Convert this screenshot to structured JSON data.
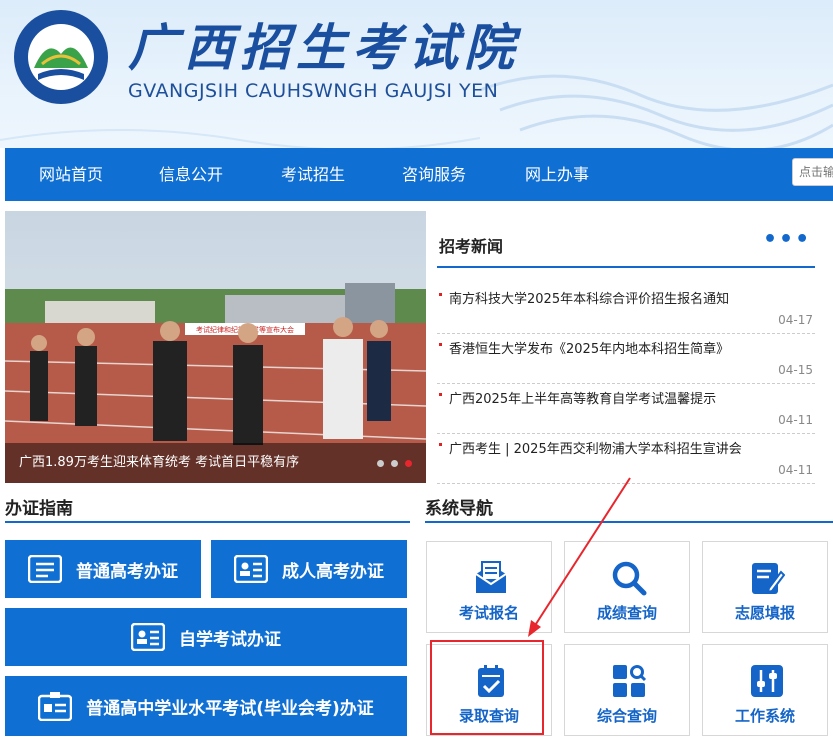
{
  "header": {
    "title": "广西招生考试院",
    "subtitle": "GVANGJSIH CAUHSWNGH GAUJSI YEN",
    "logo_text_top": "广西招生考试院",
    "logo_text_bottom": "GVANGJSIH CAUHSWNGH GAUJSI YEN"
  },
  "nav": {
    "items": [
      "网站首页",
      "信息公开",
      "考试招生",
      "咨询服务",
      "网上办事"
    ],
    "search_placeholder": "点击输"
  },
  "carousel": {
    "caption": "广西1.89万考生迎来体育统考 考试首日平稳有序",
    "banner_text": "考试纪律和纪律要求等宣布大会",
    "active_slide": 3,
    "slide_count": 3
  },
  "news": {
    "title": "招考新闻",
    "more": "•••",
    "items": [
      {
        "text": "南方科技大学2025年本科综合评价招生报名通知",
        "date": "04-17"
      },
      {
        "text": "香港恒生大学发布《2025年内地本科招生简章》",
        "date": "04-15"
      },
      {
        "text": "广西2025年上半年高等教育自学考试温馨提示",
        "date": "04-11"
      },
      {
        "text": "广西考生 | 2025年西交利物浦大学本科招生宣讲会",
        "date": "04-11"
      }
    ]
  },
  "guide": {
    "title": "办证指南",
    "buttons": [
      "普通高考办证",
      "成人高考办证",
      "自学考试办证",
      "普通高中学业水平考试(毕业会考)办证"
    ]
  },
  "system_nav": {
    "title": "系统导航",
    "tiles": [
      {
        "label": "考试报名",
        "icon": "exam-registration-icon"
      },
      {
        "label": "成绩查询",
        "icon": "search-icon"
      },
      {
        "label": "志愿填报",
        "icon": "edit-form-icon"
      },
      {
        "label": "录取查询",
        "icon": "clipboard-check-icon"
      },
      {
        "label": "综合查询",
        "icon": "grid-search-icon"
      },
      {
        "label": "工作系统",
        "icon": "sliders-icon"
      }
    ]
  },
  "colors": {
    "primary": "#0f6fd3",
    "title_blue": "#1a4e9e",
    "highlight": "#e8262d"
  }
}
